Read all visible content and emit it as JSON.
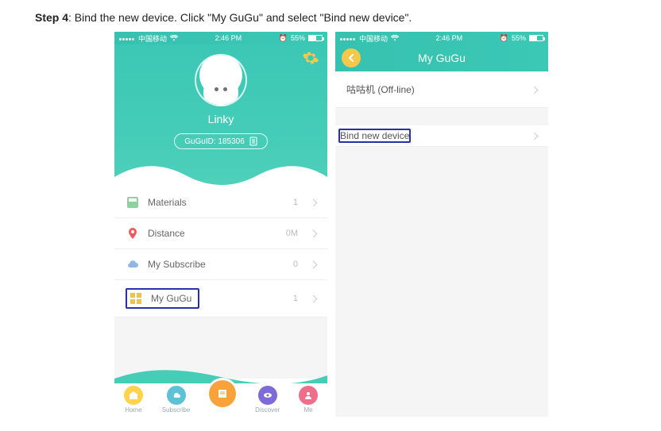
{
  "instruction": {
    "step_label": "Step 4",
    "text": ": Bind the new device. Click \"My GuGu\" and select \"Bind new device\"."
  },
  "statusbar": {
    "carrier": "中国移动",
    "time": "2:46 PM",
    "battery_pct": "55%",
    "alarm_glyph": "⏰"
  },
  "screen1": {
    "username": "Linky",
    "gugu_id_label": "GuGuID: 185306",
    "rows": {
      "materials": {
        "label": "Materials",
        "value": "1"
      },
      "distance": {
        "label": "Distance",
        "value": "0M"
      },
      "subscribe": {
        "label": "My Subscribe",
        "value": "0"
      },
      "mygugu": {
        "label": "My GuGu",
        "value": "1"
      }
    },
    "tabs": {
      "home": "Home",
      "subscribe": "Subscribe",
      "discover": "Discover",
      "me": "Me"
    }
  },
  "screen2": {
    "title": "My GuGu",
    "device_row": "咕咕机  (Off-line)",
    "bind_row": "Bind new device"
  }
}
